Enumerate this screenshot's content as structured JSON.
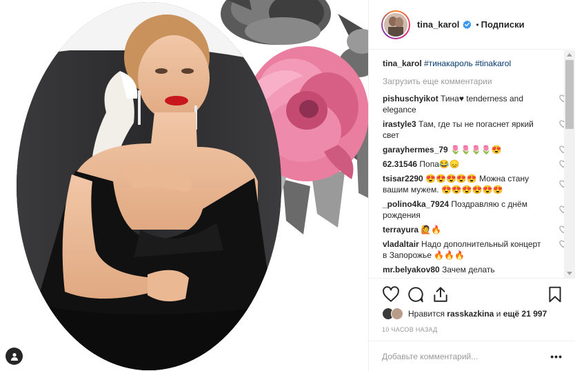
{
  "post": {
    "user_tag_icon": "user-silhouette-icon"
  },
  "header": {
    "username": "tina_karol",
    "verified_icon": "verified-badge-icon",
    "dot": "•",
    "follow": "Подписки"
  },
  "caption": {
    "username": "tina_karol",
    "text": "#тинакароль #tinakarol"
  },
  "load_more": "Загрузить еще комментарии",
  "comments": [
    {
      "user": "pishuschyikot",
      "text": "Тина♥ tenderness and elegance"
    },
    {
      "user": "irastyle3",
      "text": "Там, где ты не погаснет яркий свет"
    },
    {
      "user": "garayhermes_79",
      "text": "🌷🌷🌷🌷😍"
    },
    {
      "user": "62.31546",
      "text": "Попа😂😞"
    },
    {
      "user": "tsisar2290",
      "text": "😍😍😍😍😍 Можна стану вашим мужем. 😍😍😍😍😍😍"
    },
    {
      "user": "_polino4ka_7924",
      "text": "Поздравляю с днём рождения"
    },
    {
      "user": "terrayura",
      "text": "🙋🔥"
    },
    {
      "user": "vladaltair",
      "text": "Надо дополнительный концерт в Запорожье 🔥🔥🔥"
    },
    {
      "user": "mr.belyakov80",
      "text": "Зачем делать"
    }
  ],
  "actions": {
    "like_icon": "heart-icon",
    "comment_icon": "comment-bubble-icon",
    "share_icon": "share-icon",
    "save_icon": "bookmark-icon"
  },
  "likes": {
    "prefix": "Нравится",
    "user": "rasskazkina",
    "middle": "и",
    "count": "ещё 21 997"
  },
  "time": "10 часов назад",
  "add_comment": {
    "placeholder": "Добавьте комментарий...",
    "more": "•••"
  },
  "colors": {
    "link": "#003569",
    "muted": "#999999",
    "verified": "#3897f0",
    "pink_flower": "#e8739a"
  }
}
